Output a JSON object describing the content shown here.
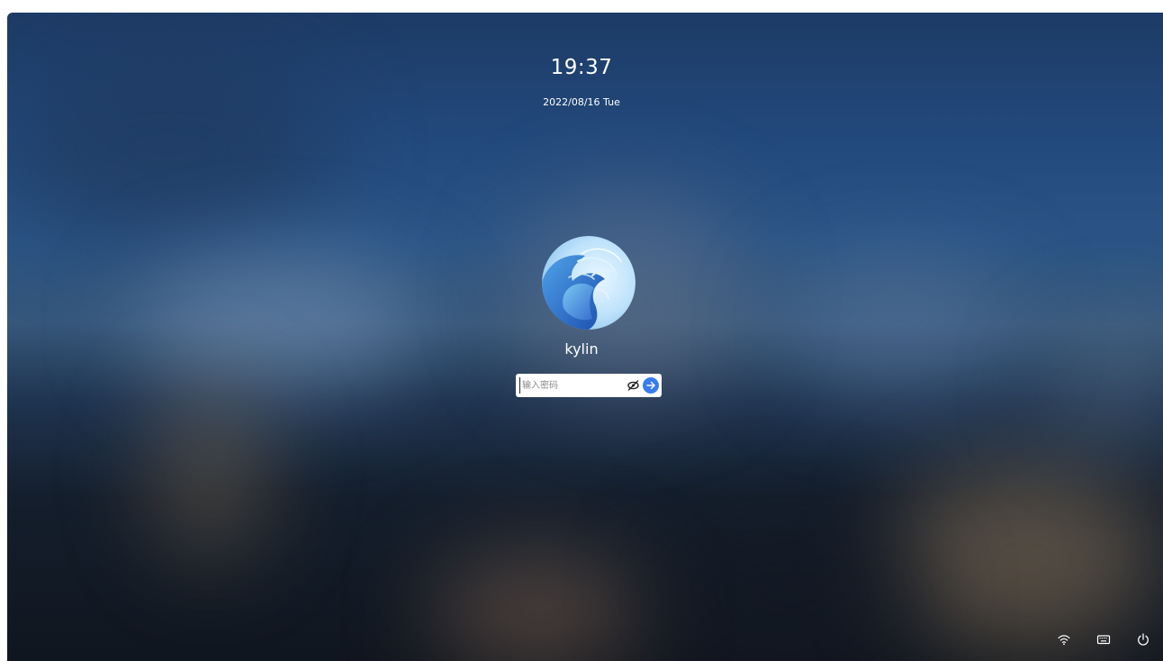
{
  "lockscreen": {
    "time": "19:37",
    "date": "2022/08/16 Tue",
    "username": "kylin",
    "password_placeholder": "输入密码"
  },
  "colors": {
    "submit_button": "#3a7bf0",
    "text": "#ffffff"
  },
  "icons": {
    "avatar": "kylin-dragon-logo",
    "password_visibility": "eye-off-icon",
    "submit": "arrow-right-icon",
    "tray": [
      "wifi-icon",
      "keyboard-icon",
      "power-icon"
    ]
  }
}
